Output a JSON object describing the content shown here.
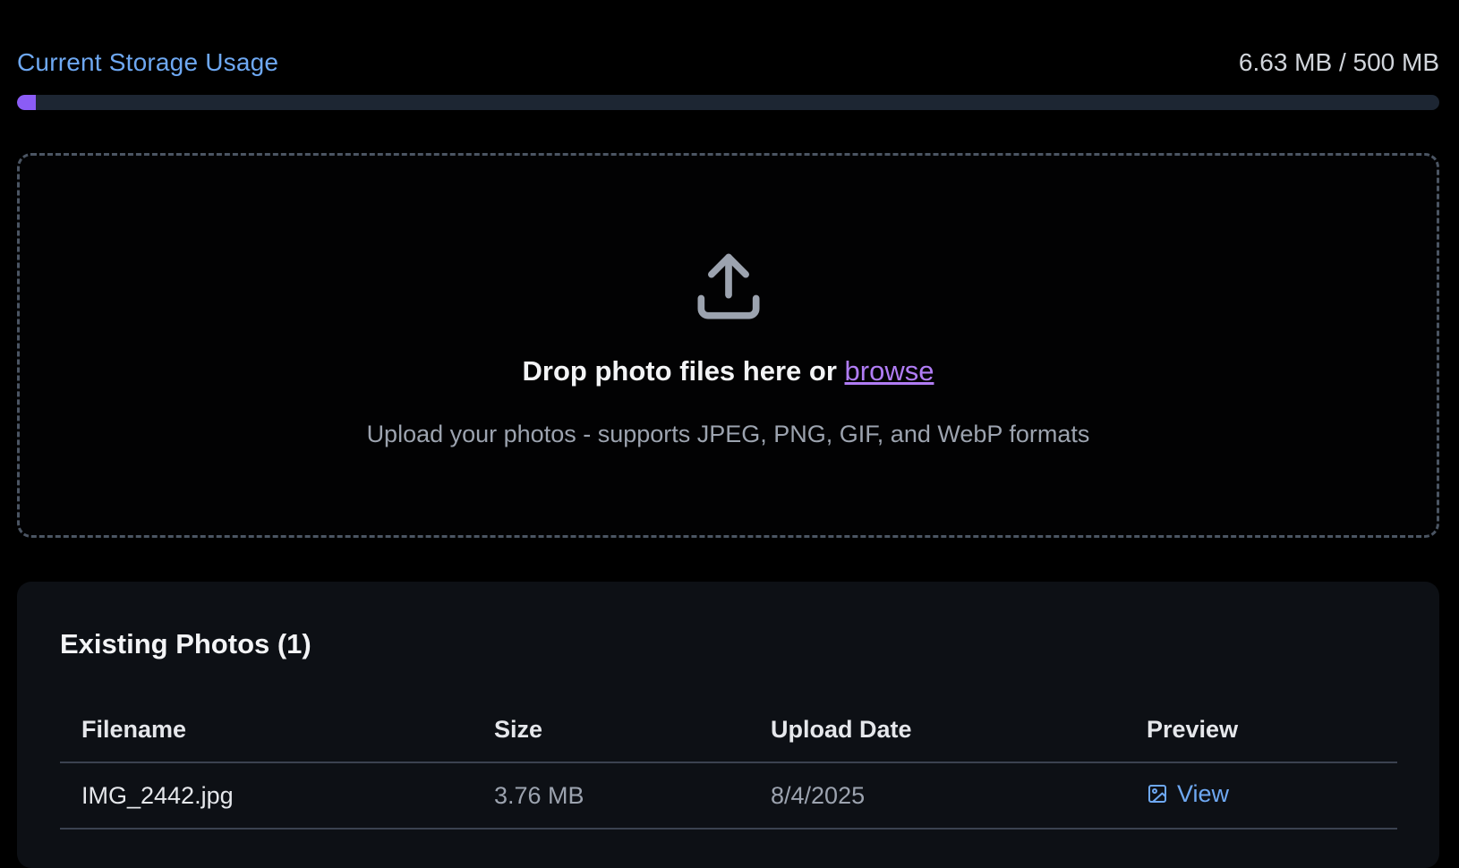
{
  "storage": {
    "label": "Current Storage Usage",
    "value": "6.63 MB / 500 MB",
    "used_fraction": 0.0133,
    "fill_color": "#8b5cf6",
    "track_color": "#1d2633"
  },
  "dropzone": {
    "icon": "upload-icon",
    "title_prefix": "Drop photo files here or",
    "browse_label": "browse",
    "subtitle": "Upload your photos - supports JPEG, PNG, GIF, and WebP formats"
  },
  "photos": {
    "title": "Existing Photos (1)",
    "columns": [
      "Filename",
      "Size",
      "Upload Date",
      "Preview"
    ],
    "rows": [
      {
        "filename": "IMG_2442.jpg",
        "size": "3.76 MB",
        "date": "8/4/2025",
        "preview_label": "View",
        "preview_icon": "image-icon"
      }
    ]
  }
}
